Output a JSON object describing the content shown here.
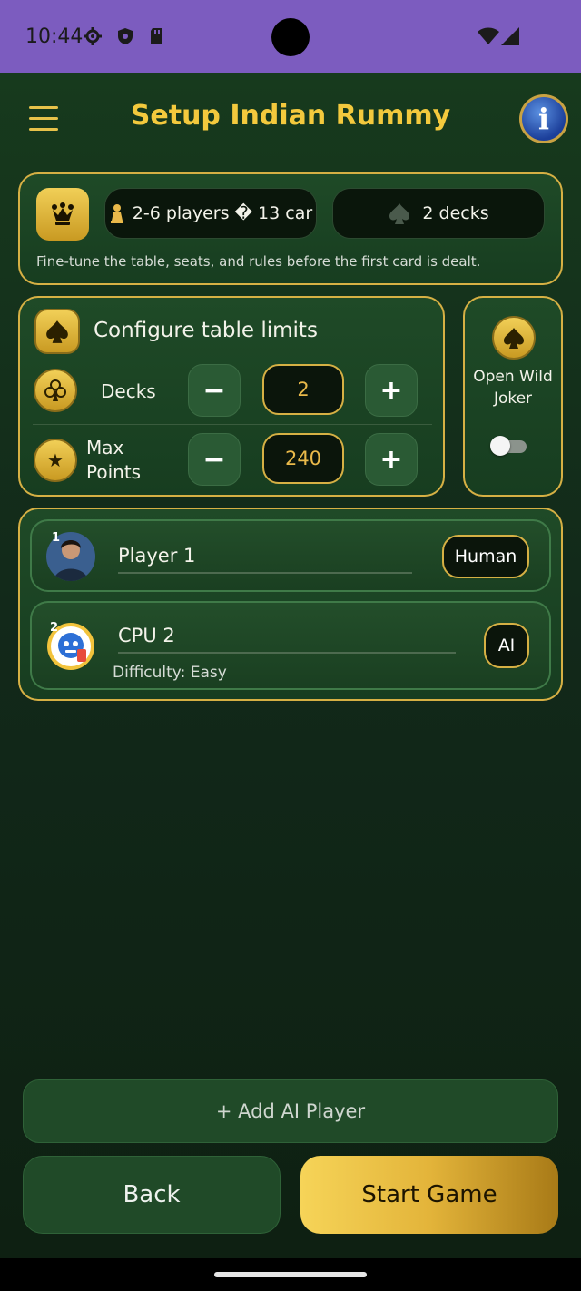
{
  "status_bar": {
    "time": "10:44",
    "icons": [
      "gear-icon",
      "shield-icon",
      "sd-card-icon",
      "wifi-icon",
      "signal-icon"
    ]
  },
  "header": {
    "title": "Setup Indian Rummy",
    "menu_icon": "hamburger-menu-icon",
    "info_icon": "info-icon",
    "info_glyph": "i"
  },
  "summary": {
    "players_chip": "2-6 players � 13 car",
    "decks_chip": "2 decks",
    "description": "Fine-tune the table, seats, and rules before the first card is dealt."
  },
  "limits": {
    "heading": "Configure table limits",
    "decks_label": "Decks",
    "decks_value": "2",
    "max_points_label_line1": "Max",
    "max_points_label_line2": "Points",
    "max_points_value": "240",
    "minus": "−",
    "plus": "+"
  },
  "wild_joker": {
    "label_line1": "Open Wild",
    "label_line2": "Joker",
    "enabled": false
  },
  "players": [
    {
      "number": "1",
      "name": "Player 1",
      "type": "Human"
    },
    {
      "number": "2",
      "name": "CPU 2",
      "type": "AI",
      "difficulty": "Difficulty: Easy"
    }
  ],
  "actions": {
    "add_ai": "+ Add AI Player",
    "back": "Back",
    "start": "Start Game"
  },
  "colors": {
    "accent_gold": "#f3c93d",
    "background_green": "#173a1d",
    "status_bar_purple": "#7c5cbf"
  }
}
